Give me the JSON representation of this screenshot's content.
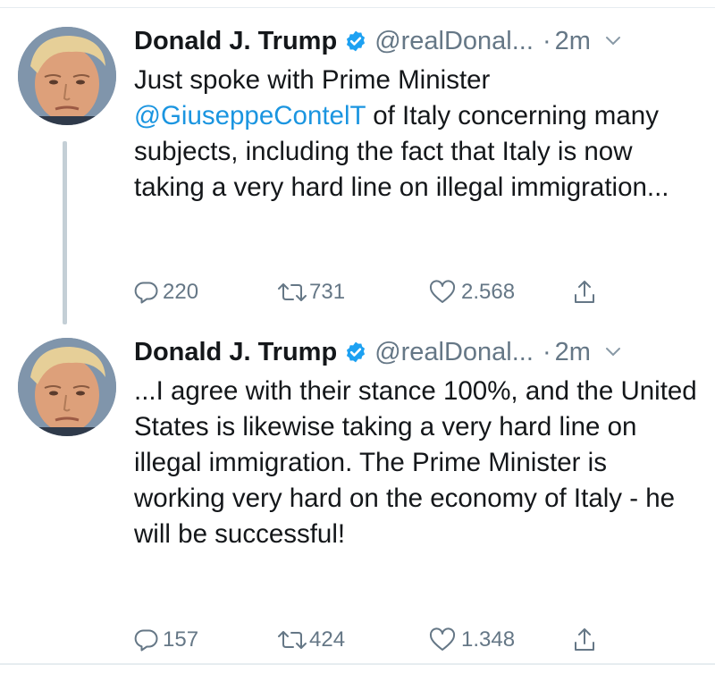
{
  "tweets": [
    {
      "name": "Donald J. Trump",
      "handle": "@realDonal...",
      "dot": "·",
      "time": "2m",
      "text_before": "Just spoke with Prime Minister ",
      "mention": "@GiuseppeContelT",
      "text_after": " of Italy concerning many subjects, including the fact that Italy is now taking a very hard line on illegal immigration...",
      "replies": "220",
      "retweets": "731",
      "likes": "2.568"
    },
    {
      "name": "Donald J. Trump",
      "handle": "@realDonal...",
      "dot": "·",
      "time": "2m",
      "text": "...I agree with their stance 100%, and the United States is likewise taking a very hard line on illegal immigration. The Prime Minister is working very hard on the economy of Italy - he will be successful!",
      "replies": "157",
      "retweets": "424",
      "likes": "1.348"
    }
  ],
  "icons": {
    "avatar": "avatar",
    "verified": "verified-badge-icon",
    "caret": "chevron-down-icon",
    "reply": "reply-icon",
    "retweet": "retweet-icon",
    "like": "heart-icon",
    "share": "share-icon"
  },
  "colors": {
    "text": "#14171a",
    "muted": "#657786",
    "link": "#1b95e0",
    "verified": "#1da1f2",
    "thread_line": "#c4cfd6"
  }
}
